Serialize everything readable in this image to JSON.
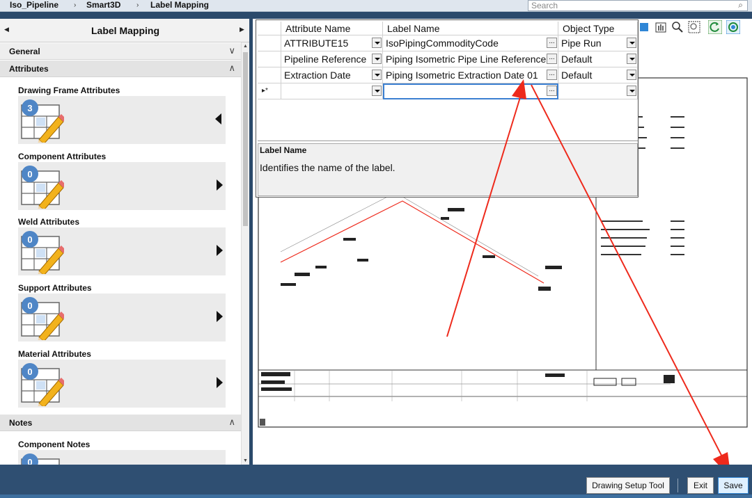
{
  "breadcrumb": {
    "items": [
      "Iso_Pipeline",
      "Smart3D",
      "Label Mapping"
    ]
  },
  "search": {
    "placeholder": "Search"
  },
  "left_panel": {
    "title": "Label Mapping",
    "sections": [
      {
        "label": "General",
        "expanded": false
      },
      {
        "label": "Attributes",
        "expanded": true
      },
      {
        "label": "Notes",
        "expanded": true
      }
    ],
    "attribute_categories": [
      {
        "label": "Drawing Frame Attributes",
        "count": "3",
        "arrow": "left"
      },
      {
        "label": "Component Attributes",
        "count": "0",
        "arrow": "right"
      },
      {
        "label": "Weld Attributes",
        "count": "0",
        "arrow": "right"
      },
      {
        "label": "Support Attributes",
        "count": "0",
        "arrow": "right"
      },
      {
        "label": "Material Attributes",
        "count": "0",
        "arrow": "right"
      }
    ],
    "notes_categories": [
      {
        "label": "Component Notes",
        "count": "0"
      }
    ]
  },
  "mapping_grid": {
    "columns": [
      "Attribute Name",
      "Label Name",
      "Object Type"
    ],
    "rows": [
      {
        "attribute": "ATTRIBUTE15",
        "label": "IsoPipingCommodityCode",
        "object_type": "Pipe Run"
      },
      {
        "attribute": "Pipeline Reference",
        "label": "Piping Isometric Pipe Line Reference",
        "object_type": "Default"
      },
      {
        "attribute": "Extraction Date",
        "label": "Piping Isometric Extraction Date 01",
        "object_type": "Default"
      }
    ],
    "new_row_marker": "▸*",
    "help": {
      "title": "Label Name",
      "text": "Identifies the name of the label."
    }
  },
  "footer": {
    "drawing_setup_label": "Drawing Setup Tool",
    "exit_label": "Exit",
    "save_label": "Save"
  },
  "colors": {
    "accent": "#2f86d6",
    "annotation_arrow": "#ee2a1c",
    "footer_bg": "#2f4f72"
  }
}
